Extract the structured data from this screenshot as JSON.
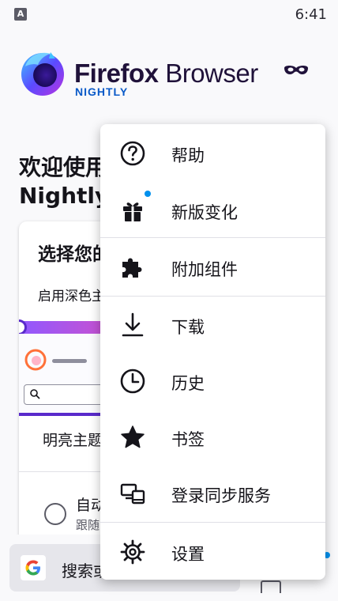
{
  "status_bar": {
    "app_icon_letter": "A",
    "time": "6:41"
  },
  "header": {
    "brand_bold": "Firefox",
    "brand_light": " Browser",
    "edition": "NIGHTLY",
    "private_mode_icon": "mask-icon"
  },
  "welcome": {
    "line1": "欢迎使用",
    "line2": "Nightly"
  },
  "theme_card": {
    "title": "选择您的主题",
    "subtitle": "启用深色主题",
    "light_label": "明亮主题",
    "auto_label": "自动",
    "auto_sub": "跟随系统"
  },
  "bottom_bar": {
    "search_text": "搜索或输入网址"
  },
  "menu": {
    "items": [
      {
        "label": "帮助",
        "icon": "help-icon"
      },
      {
        "label": "新版变化",
        "icon": "gift-icon",
        "has_badge": true
      },
      {
        "label": "附加组件",
        "icon": "puzzle-icon"
      },
      {
        "label": "下载",
        "icon": "download-icon"
      },
      {
        "label": "历史",
        "icon": "clock-icon"
      },
      {
        "label": "书签",
        "icon": "star-icon"
      },
      {
        "label": "登录同步服务",
        "icon": "sync-devices-icon"
      },
      {
        "label": "设置",
        "icon": "gear-icon"
      }
    ]
  },
  "colors": {
    "accent": "#0090ed",
    "text": "#15141a",
    "nightly_blue": "#0a5ac8",
    "menu_bg": "#ffffff"
  }
}
